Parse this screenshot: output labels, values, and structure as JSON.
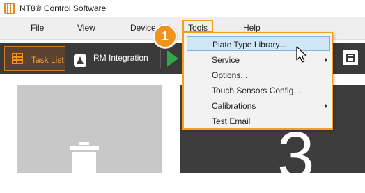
{
  "window": {
    "title": "NT8® Control Software"
  },
  "menubar": {
    "items": [
      {
        "label": "File"
      },
      {
        "label": "View"
      },
      {
        "label": "Device"
      },
      {
        "label": "Tools"
      },
      {
        "label": "Help"
      }
    ]
  },
  "callout": {
    "number": "1"
  },
  "toolbar": {
    "task_list_label": "Task List",
    "rm_integration_label": "RM Integration"
  },
  "tools_menu": {
    "items": [
      {
        "label": "Plate Type Library...",
        "highlighted": true
      },
      {
        "label": "Service",
        "submenu": true
      },
      {
        "label": "Options..."
      },
      {
        "label": "Touch Sensors Config..."
      },
      {
        "label": "Calibrations",
        "submenu": true
      },
      {
        "label": "Test Email"
      }
    ]
  },
  "main": {
    "right_panel_number": "3"
  },
  "colors": {
    "accent": "#f0931e",
    "toolbar_bg": "#3a3a3a",
    "highlight": "#cfe7f7",
    "play_green": "#2ea84a"
  }
}
